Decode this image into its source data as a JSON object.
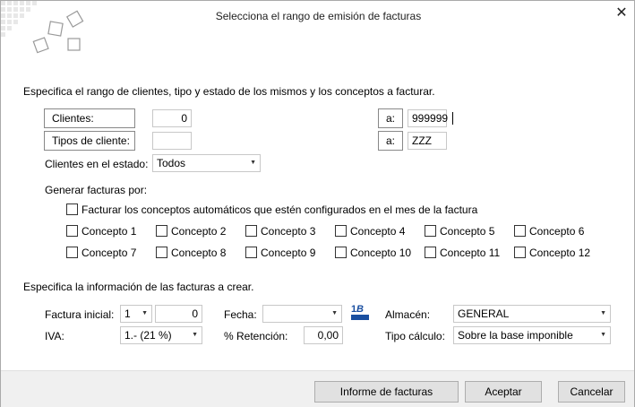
{
  "dialog": {
    "title": "Selecciona el rango de emisión de facturas",
    "close_label": "✕"
  },
  "range": {
    "heading": "Especifica el rango de clientes, tipo y estado de los mismos y los conceptos a facturar.",
    "clientes_label": "Clientes:",
    "clientes_from": "0",
    "clientes_a_label": "a:",
    "clientes_to": "999999",
    "tipos_label": "Tipos de cliente:",
    "tipos_from": "",
    "tipos_a_label": "a:",
    "tipos_to": "ZZZ",
    "estado_label": "Clientes en el estado:",
    "estado_value": "Todos"
  },
  "generar": {
    "label": "Generar facturas por:",
    "auto_label": "Facturar los conceptos automáticos que estén configurados en el mes de la factura",
    "conceptos": [
      "Concepto 1",
      "Concepto 2",
      "Concepto 3",
      "Concepto 4",
      "Concepto 5",
      "Concepto 6",
      "Concepto 7",
      "Concepto 8",
      "Concepto 9",
      "Concepto 10",
      "Concepto 11",
      "Concepto 12"
    ]
  },
  "info": {
    "heading": "Especifica la información de las facturas a crear.",
    "factura_label": "Factura inicial:",
    "serie_value": "1",
    "numero_value": "0",
    "fecha_label": "Fecha:",
    "fecha_value": "",
    "almacen_label": "Almacén:",
    "almacen_value": "GENERAL",
    "iva_label": "IVA:",
    "iva_value": "1.- (21 %)",
    "retencion_label": "% Retención:",
    "retencion_value": "0,00",
    "tipo_label": "Tipo cálculo:",
    "tipo_value": "Sobre la base imponible"
  },
  "buttons": {
    "informe": "Informe de facturas",
    "aceptar": "Aceptar",
    "cancelar": "Cancelar"
  }
}
